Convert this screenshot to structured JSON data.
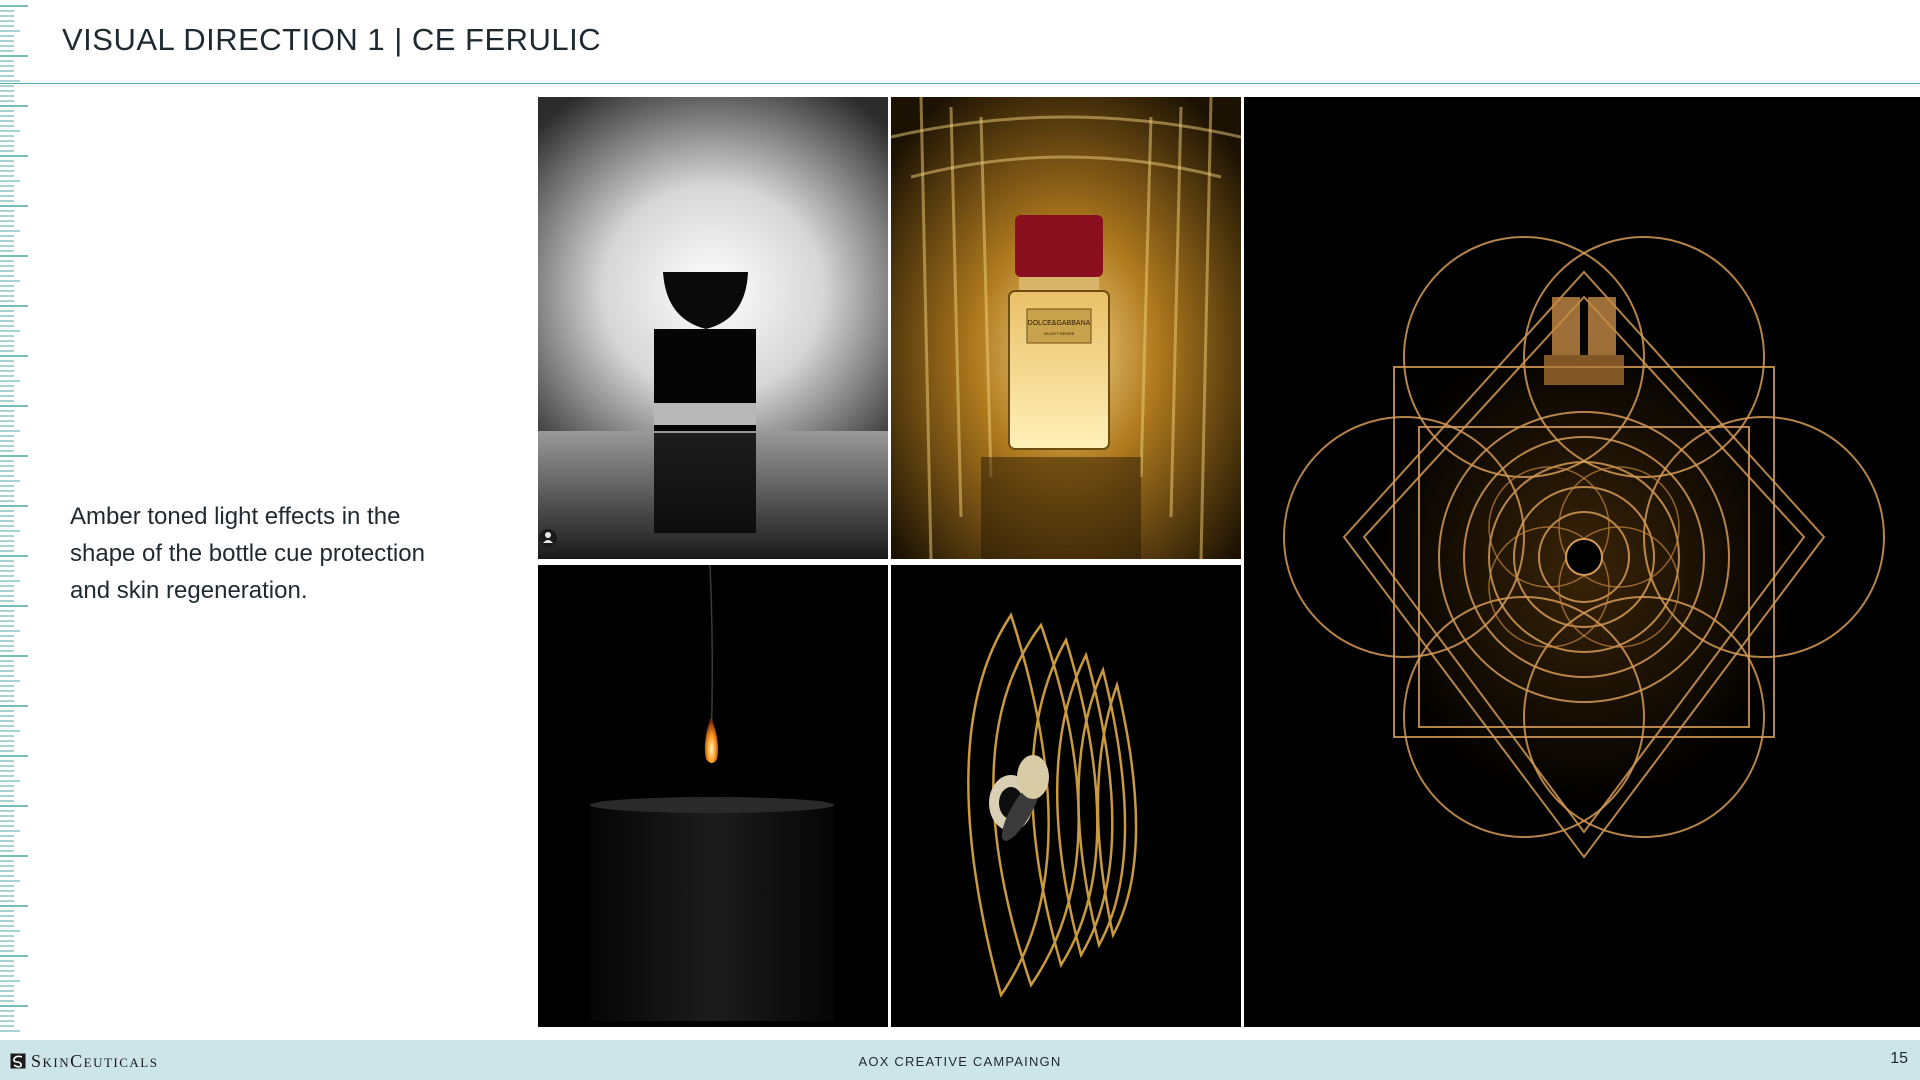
{
  "slide": {
    "title": "VISUAL DIRECTION 1 | CE FERULIC",
    "body": "Amber toned light effects in the shape of the bottle cue protection and skin regeneration."
  },
  "images": [
    {
      "name": "black-perfume-bottle-photo"
    },
    {
      "name": "golden-perfume-bottle-tunnel-photo",
      "label": "DOLCE&GABBANA",
      "sublabel": "VELVET DESIRE"
    },
    {
      "name": "candle-flame-photo"
    },
    {
      "name": "panther-watch-gold-frames-photo"
    },
    {
      "name": "amber-geometric-bottle-light-photo"
    }
  ],
  "footer": {
    "brand": "SkinCeuticals",
    "campaign": "AOX CREATIVE CAMPAINGN",
    "page": "15"
  },
  "colors": {
    "accent": "#4fa7a8",
    "footer_bg": "#cde4e8",
    "amber": "#e0a85a"
  }
}
